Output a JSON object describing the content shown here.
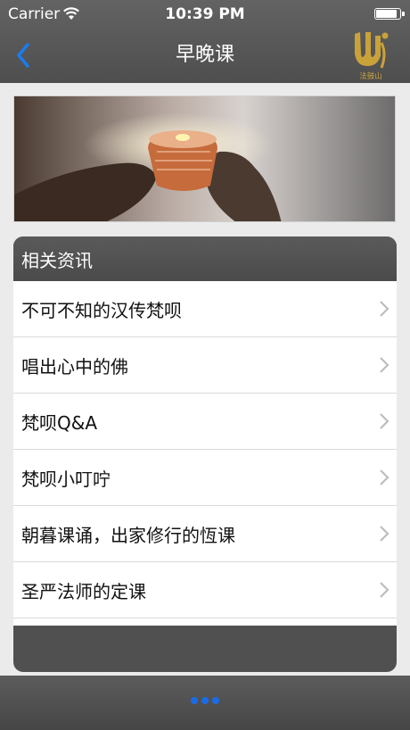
{
  "status_bar": {
    "carrier": "Carrier",
    "time": "10:39 PM",
    "battery_level": 0.9
  },
  "nav": {
    "title": "早晚课",
    "back_icon": "chevron-left-icon",
    "logo_icon": "dharma-drum-logo-icon",
    "logo_text": "法鼓山"
  },
  "hero": {
    "image": "hands-holding-candle-photo"
  },
  "section": {
    "header": "相关资讯",
    "items": [
      {
        "label": "不可不知的汉传梵呗"
      },
      {
        "label": "唱出心中的佛"
      },
      {
        "label": "梵呗Q&A"
      },
      {
        "label": "梵呗小叮咛"
      },
      {
        "label": "朝暮课诵，出家修行的恆课"
      },
      {
        "label": "圣严法师的定课"
      }
    ]
  },
  "tab_bar": {
    "more_icon": "more-dots-icon"
  },
  "colors": {
    "accent": "#1a6ce6",
    "bar": "#555555",
    "logo": "#c9a23a"
  }
}
